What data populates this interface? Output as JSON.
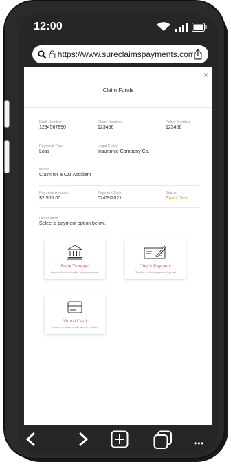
{
  "status": {
    "time": "12:00"
  },
  "browser": {
    "url": "https://www.sureclaimspayments.com"
  },
  "modal": {
    "title": "Claim Funds",
    "close": "×",
    "fields": {
      "draft_number": {
        "label": "Draft Number",
        "value": "1234567890"
      },
      "claim_number": {
        "label": "Claim Number",
        "value": "123456"
      },
      "policy_number": {
        "label": "Policy Number",
        "value": "123456"
      },
      "payment_type": {
        "label": "Payment Type",
        "value": "Loss"
      },
      "legal_entity": {
        "label": "Legal Entity",
        "value": "Insurance Company Co."
      },
      "memo": {
        "label": "Memo",
        "value": "Claim for a Car Accident"
      },
      "payment_amount": {
        "label": "Payment Amount",
        "value": "$2,500.00"
      },
      "payment_date": {
        "label": "Payment Date",
        "value": "02/09/2021"
      },
      "status": {
        "label": "Status",
        "value": "Email Sent",
        "color": "#f0a018"
      }
    },
    "destination": {
      "label": "Destination",
      "prompt": "Select a payment option below."
    },
    "options": [
      {
        "title": "Bank Transfer",
        "desc": "Deposit funds directly into your account",
        "icon": "bank-icon"
      },
      {
        "title": "Check Payment",
        "desc": "Receive a check payment by mail",
        "icon": "check-icon"
      },
      {
        "title": "Virtual Card",
        "desc": "Receive a virtual credit card in minutes",
        "icon": "card-icon"
      }
    ],
    "accent": "#e0558f"
  },
  "toolbar": {
    "back": "<",
    "forward": ">",
    "more": "•••"
  }
}
